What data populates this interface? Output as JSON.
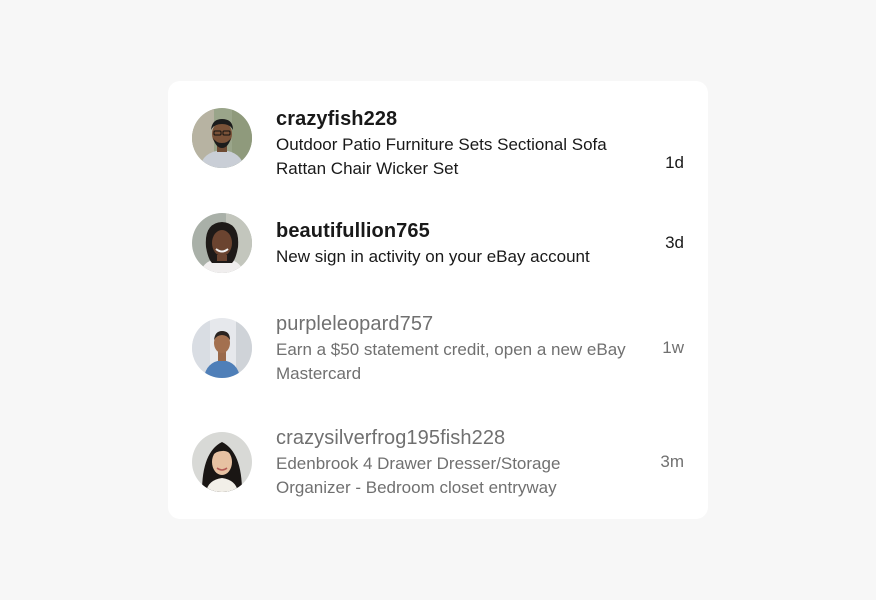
{
  "messages": [
    {
      "username": "crazyfish228",
      "preview": "Outdoor Patio Furniture Sets Sectional Sofa Rattan Chair Wicker Set",
      "time": "1d",
      "unread": true,
      "avatar": "man-with-glasses-avatar"
    },
    {
      "username": "beautifullion765",
      "preview": "New sign in activity on your eBay account",
      "time": "3d",
      "unread": true,
      "avatar": "woman-smiling-avatar"
    },
    {
      "username": "purpleleopard757",
      "preview": "Earn a $50 statement credit, open a new eBay Mastercard",
      "time": "1w",
      "unread": false,
      "avatar": "man-in-blue-shirt-avatar"
    },
    {
      "username": "crazysilverfrog195fish228",
      "preview": "Edenbrook 4 Drawer Dresser/Storage Organizer - Bedroom closet entryway",
      "time": "3m",
      "unread": false,
      "avatar": "woman-long-hair-avatar"
    }
  ]
}
